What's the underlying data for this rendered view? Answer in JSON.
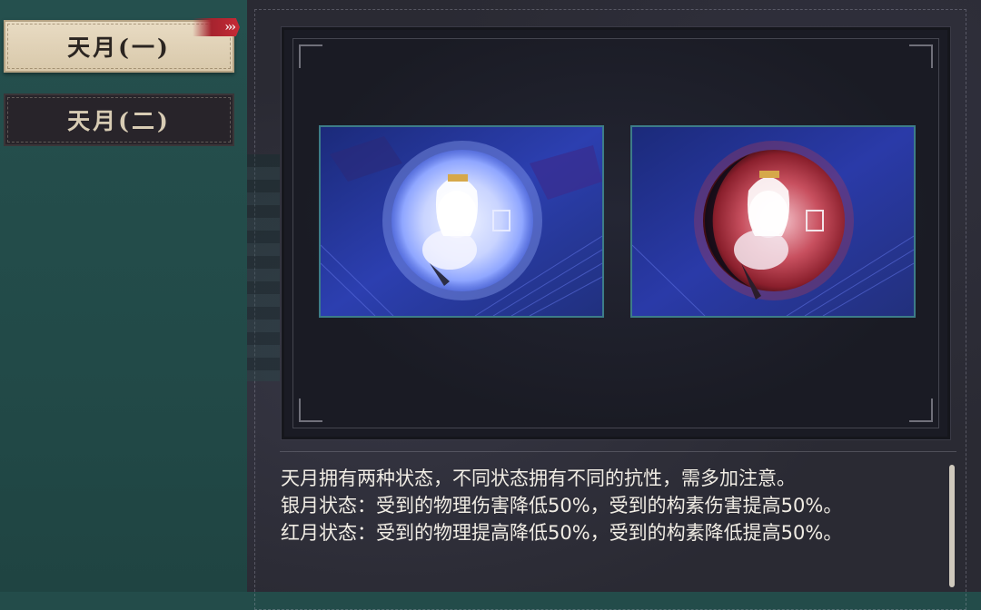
{
  "sidebar": {
    "tabs": [
      {
        "label": "天月(一)",
        "active": true,
        "marker": "›››"
      },
      {
        "label": "天月(二)",
        "active": false
      }
    ]
  },
  "viewer": {
    "images": [
      {
        "state": "silver",
        "icon": "silver-moon-state-illustration"
      },
      {
        "state": "red",
        "icon": "red-moon-state-illustration"
      }
    ]
  },
  "description": {
    "lines": [
      "天月拥有两种状态，不同状态拥有不同的抗性，需多加注意。",
      "银月状态：受到的物理伤害降低50%，受到的构素伤害提高50%。",
      "红月状态：受到的物理提高降低50%，受到的构素降低提高50%。"
    ]
  },
  "colors": {
    "sidebar_bg": "#234c4a",
    "tab_active_bg": "#e9dcc4",
    "tab_inactive_bg": "#28242a",
    "marker": "#c72a36",
    "panel_bg": "#2a2a33",
    "image_border": "#3d7c88"
  }
}
